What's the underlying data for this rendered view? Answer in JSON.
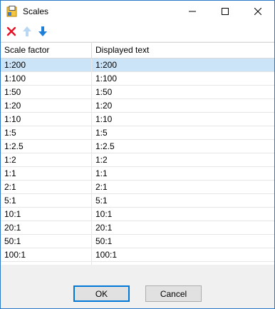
{
  "window": {
    "title": "Scales",
    "app_icon": "scales-app-icon"
  },
  "titlebar_buttons": {
    "minimize_icon": "minimize-icon",
    "maximize_icon": "maximize-icon",
    "close_icon": "close-icon"
  },
  "toolbar": {
    "delete_icon": "delete-x-icon",
    "move_up_icon": "arrow-up-icon",
    "move_down_icon": "arrow-down-icon",
    "colors": {
      "delete": "#e81123",
      "arrow_enabled": "#1e7fd8",
      "arrow_disabled": "#b9d7f2"
    }
  },
  "table": {
    "columns": [
      "Scale factor",
      "Displayed text"
    ],
    "rows": [
      {
        "scale": "1:200",
        "text": "1:200",
        "selected": true
      },
      {
        "scale": "1:100",
        "text": "1:100"
      },
      {
        "scale": "1:50",
        "text": "1:50"
      },
      {
        "scale": "1:20",
        "text": "1:20"
      },
      {
        "scale": "1:10",
        "text": "1:10"
      },
      {
        "scale": "1:5",
        "text": "1:5"
      },
      {
        "scale": "1:2.5",
        "text": "1:2.5"
      },
      {
        "scale": "1:2",
        "text": "1:2"
      },
      {
        "scale": "1:1",
        "text": "1:1"
      },
      {
        "scale": "2:1",
        "text": "2:1"
      },
      {
        "scale": "5:1",
        "text": "5:1"
      },
      {
        "scale": "10:1",
        "text": "10:1"
      },
      {
        "scale": "20:1",
        "text": "20:1"
      },
      {
        "scale": "50:1",
        "text": "50:1"
      },
      {
        "scale": "100:1",
        "text": "100:1"
      },
      {
        "scale": "",
        "text": ""
      }
    ],
    "selection_color": "#cce4f7"
  },
  "footer": {
    "ok_label": "OK",
    "cancel_label": "Cancel"
  }
}
